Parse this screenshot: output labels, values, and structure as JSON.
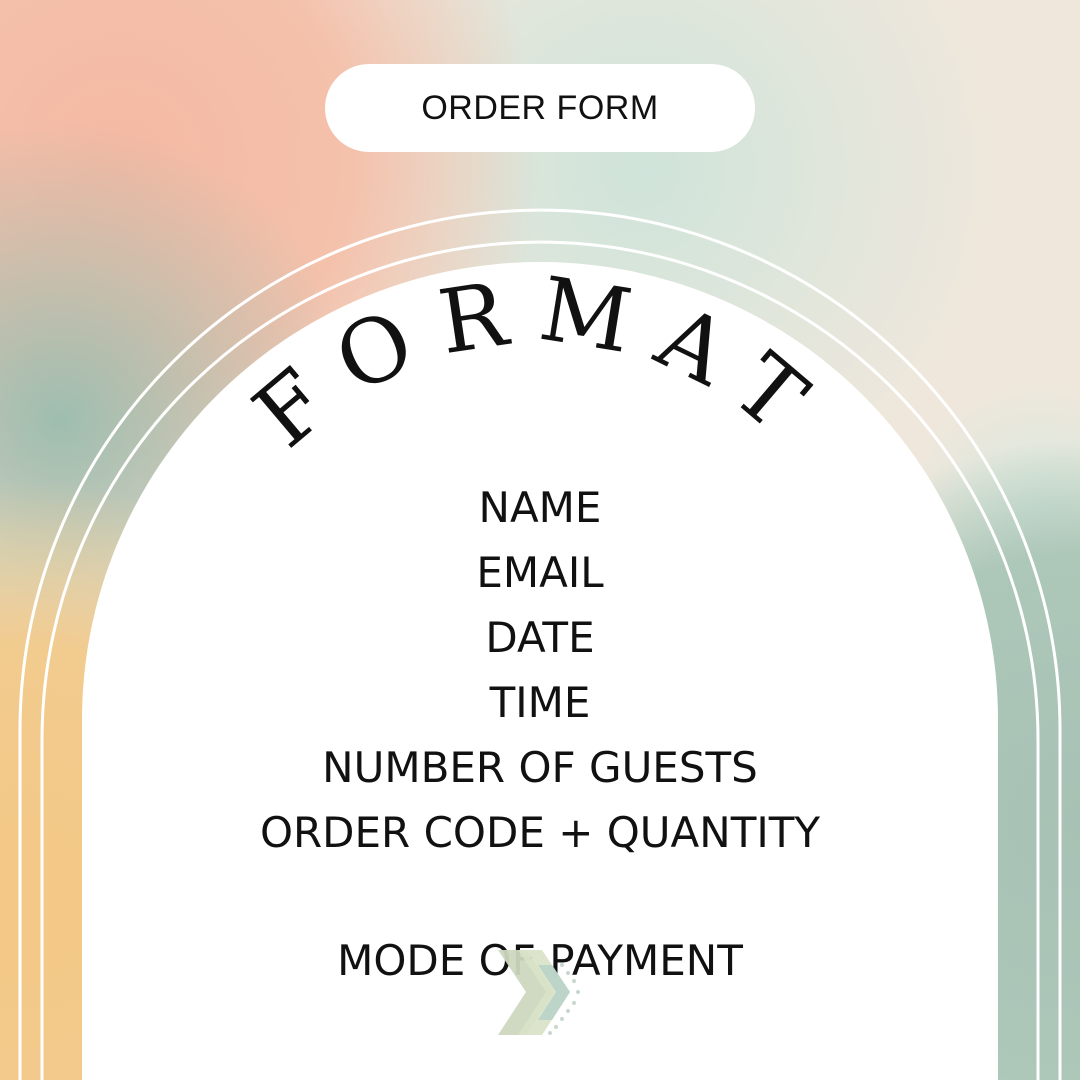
{
  "header": {
    "label": "ORDER FORM"
  },
  "title": "FORMAT",
  "fields": [
    "NAME",
    "EMAIL",
    "DATE",
    "TIME",
    "NUMBER OF GUESTS",
    "ORDER CODE + QUANTITY"
  ],
  "payment_label": "MODE OF PAYMENT",
  "decor": {
    "chevron_icon": "chevron-right-icon"
  },
  "colors": {
    "peach": "#f5bda7",
    "sage": "#a9c3b6",
    "mint": "#cfe3d9",
    "cream": "#efe7dc",
    "yellow": "#f2c98a",
    "card": "#ffffff",
    "text": "#111111"
  }
}
